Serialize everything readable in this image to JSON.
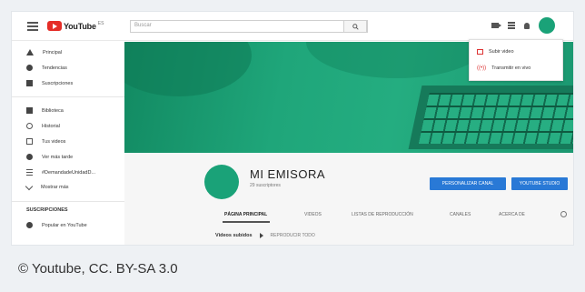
{
  "topbar": {
    "logo_text": "YouTube",
    "logo_sup": "ES",
    "search_placeholder": "Buscar"
  },
  "dropdown": {
    "items": [
      {
        "label": "Subir video",
        "icon": "upload-video-icon"
      },
      {
        "label": "Transmitir en vivo",
        "icon": "live-icon"
      }
    ]
  },
  "sidebar": {
    "items": [
      {
        "label": "Principal",
        "icon": "home-icon"
      },
      {
        "label": "Tendencias",
        "icon": "fire-icon"
      },
      {
        "label": "Suscripciones",
        "icon": "subscriptions-icon"
      },
      {
        "label": "Biblioteca",
        "icon": "library-icon"
      },
      {
        "label": "Historial",
        "icon": "history-icon"
      },
      {
        "label": "Tus videos",
        "icon": "your-videos-icon"
      },
      {
        "label": "Ver más tarde",
        "icon": "watch-later-icon"
      },
      {
        "label": "#DemandadeUnidadD...",
        "icon": "playlist-icon"
      },
      {
        "label": "Mostrar más",
        "icon": "chevron-down-icon"
      }
    ],
    "section_title": "SUSCRIPCIONES",
    "subscription_item": "Popular en YouTube"
  },
  "channel": {
    "name": "MI EMISORA",
    "subscribers": "29 suscriptores",
    "customize_button": "PERSONALIZAR CANAL",
    "studio_button": "YOUTUBE STUDIO",
    "tabs": [
      "PÁGINA PRINCIPAL",
      "VIDEOS",
      "LISTAS DE REPRODUCCIÓN",
      "CANALES",
      "ACERCA DE"
    ],
    "uploads_title": "Videos subidos",
    "play_all": "REPRODUCIR TODO"
  },
  "caption": "© Youtube, CC. BY-SA 3.0",
  "colors": {
    "brand_red": "#e52d27",
    "accent_green": "#1aa278",
    "button_blue": "#2979d6"
  }
}
